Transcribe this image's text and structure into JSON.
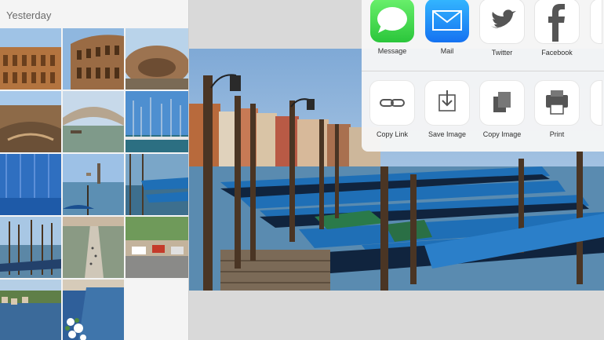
{
  "photos": {
    "section_title": "Yesterday",
    "thumbnails": [
      {
        "icon": "colosseum-photo"
      },
      {
        "icon": "colosseum-arches-photo"
      },
      {
        "icon": "colosseum-aerial-photo"
      },
      {
        "icon": "colosseum-interior-photo"
      },
      {
        "icon": "bridge-photo"
      },
      {
        "icon": "harbor-masts-photo"
      },
      {
        "icon": "blue-gondolas-photo"
      },
      {
        "icon": "venice-lagoon-photo"
      },
      {
        "icon": "gondolas-dock-photo"
      },
      {
        "icon": "gondola-poles-photo"
      },
      {
        "icon": "charles-bridge-photo"
      },
      {
        "icon": "street-cars-photo"
      },
      {
        "icon": "canal-houses-photo"
      },
      {
        "icon": "canal-flowers-photo"
      }
    ]
  },
  "share_sheet": {
    "apps": [
      {
        "label": "Message",
        "icon": "messages-icon"
      },
      {
        "label": "Mail",
        "icon": "mail-icon"
      },
      {
        "label": "Twitter",
        "icon": "twitter-icon"
      },
      {
        "label": "Facebook",
        "icon": "facebook-icon"
      }
    ],
    "actions": [
      {
        "label": "Copy Link",
        "icon": "link-icon"
      },
      {
        "label": "Save Image",
        "icon": "save-image-icon"
      },
      {
        "label": "Copy Image",
        "icon": "copy-image-icon"
      },
      {
        "label": "Print",
        "icon": "print-icon"
      }
    ]
  },
  "colors": {
    "gondola_cover": "#1f6fb6",
    "sky": "#a9c6e6",
    "water": "#5a8bb0",
    "messages_green": "#3ad24a",
    "mail_blue": "#1f8cf7"
  }
}
